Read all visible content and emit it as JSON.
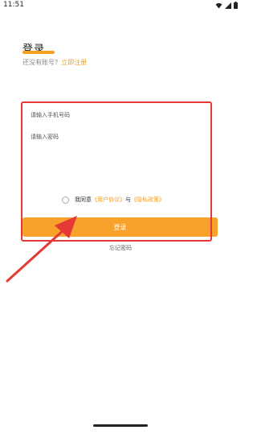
{
  "status_bar": {
    "time": "11:51"
  },
  "header": {
    "title": "登录",
    "no_account_text": "还没有账号?",
    "register_link": "立即注册"
  },
  "form": {
    "phone_placeholder": "请输入手机号码",
    "password_placeholder": "请输入密码",
    "agreement": {
      "prefix": "我同意",
      "user_agreement": "《用户协议》",
      "joiner": "与",
      "privacy_policy": "《隐私政策》"
    },
    "login_button": "登录",
    "forgot_password": "忘记密码"
  },
  "colors": {
    "accent": "#f5a020",
    "button": "#f8a22b",
    "highlight": "#e53935"
  }
}
